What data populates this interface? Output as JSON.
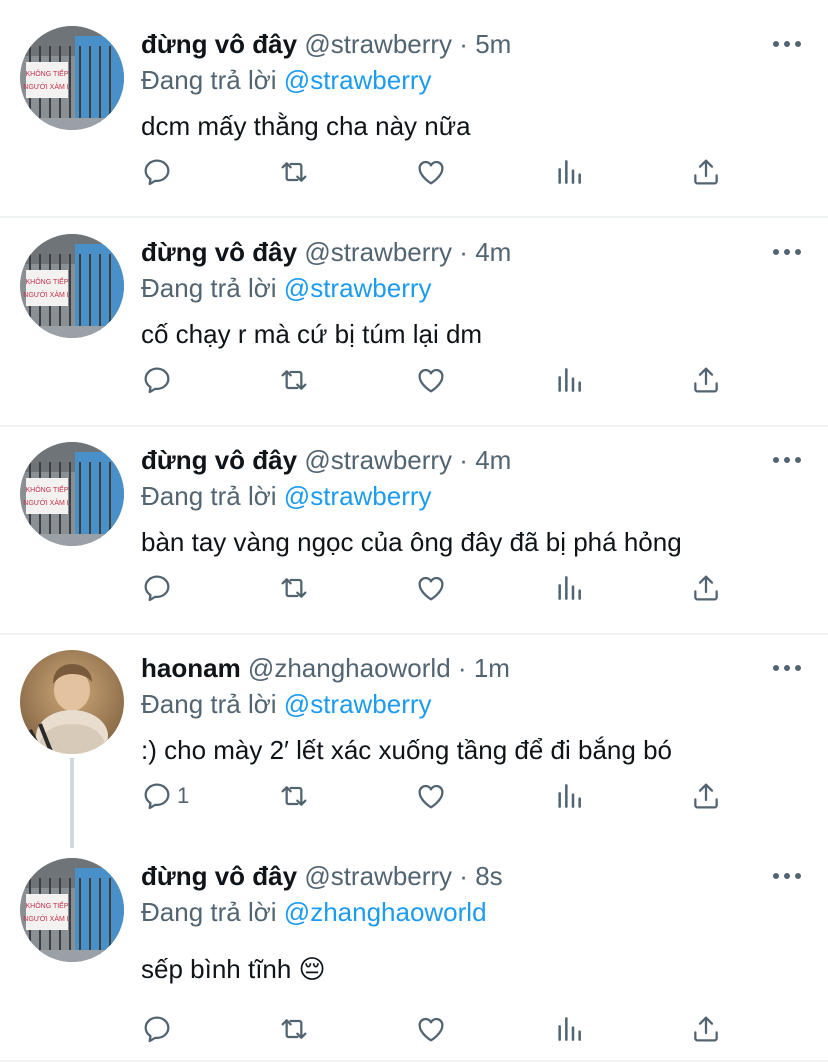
{
  "tweets": [
    {
      "name": "đừng vô đây",
      "handle": "@strawberry",
      "dot": "·",
      "time": "5m",
      "reply_prefix": "Đang trả lời",
      "reply_to": "@strawberry",
      "text": "dcm mấy thằng cha này nữa",
      "reply_count": "",
      "avatar": "sign-avatar"
    },
    {
      "name": "đừng vô đây",
      "handle": "@strawberry",
      "dot": "·",
      "time": "4m",
      "reply_prefix": "Đang trả lời",
      "reply_to": "@strawberry",
      "text": "cố chạy r mà cứ bị túm lại dm",
      "reply_count": "",
      "avatar": "sign-avatar"
    },
    {
      "name": "đừng vô đây",
      "handle": "@strawberry",
      "dot": "·",
      "time": "4m",
      "reply_prefix": "Đang trả lời",
      "reply_to": "@strawberry",
      "text": "bàn tay vàng ngọc của ông đây đã bị phá hỏng",
      "reply_count": "",
      "avatar": "sign-avatar"
    },
    {
      "name": "haonam",
      "handle": "@zhanghaoworld",
      "dot": "·",
      "time": "1m",
      "reply_prefix": "Đang trả lời",
      "reply_to": "@strawberry",
      "text": ":) cho mày 2′ lết xác xuống tầng để đi bắng bó",
      "reply_count": "1",
      "avatar": "person-avatar"
    },
    {
      "name": "đừng vô đây",
      "handle": "@strawberry",
      "dot": "·",
      "time": "8s",
      "reply_prefix": "Đang trả lời",
      "reply_to": "@zhanghaoworld",
      "text": "sếp bình tĩnh 😔",
      "reply_count": "",
      "avatar": "sign-avatar"
    }
  ],
  "avatar_sign_text": [
    "KHÔNG TIẾP",
    "NGƯỜI XÀM L"
  ],
  "colors": {
    "text": "#0f1419",
    "secondary": "#536471",
    "mention": "#1d9bf0",
    "divider": "#eff3f4",
    "thread_line": "#cfd9de"
  },
  "icons": [
    "reply-icon",
    "retweet-icon",
    "like-icon",
    "analytics-icon",
    "share-icon",
    "more-icon"
  ]
}
